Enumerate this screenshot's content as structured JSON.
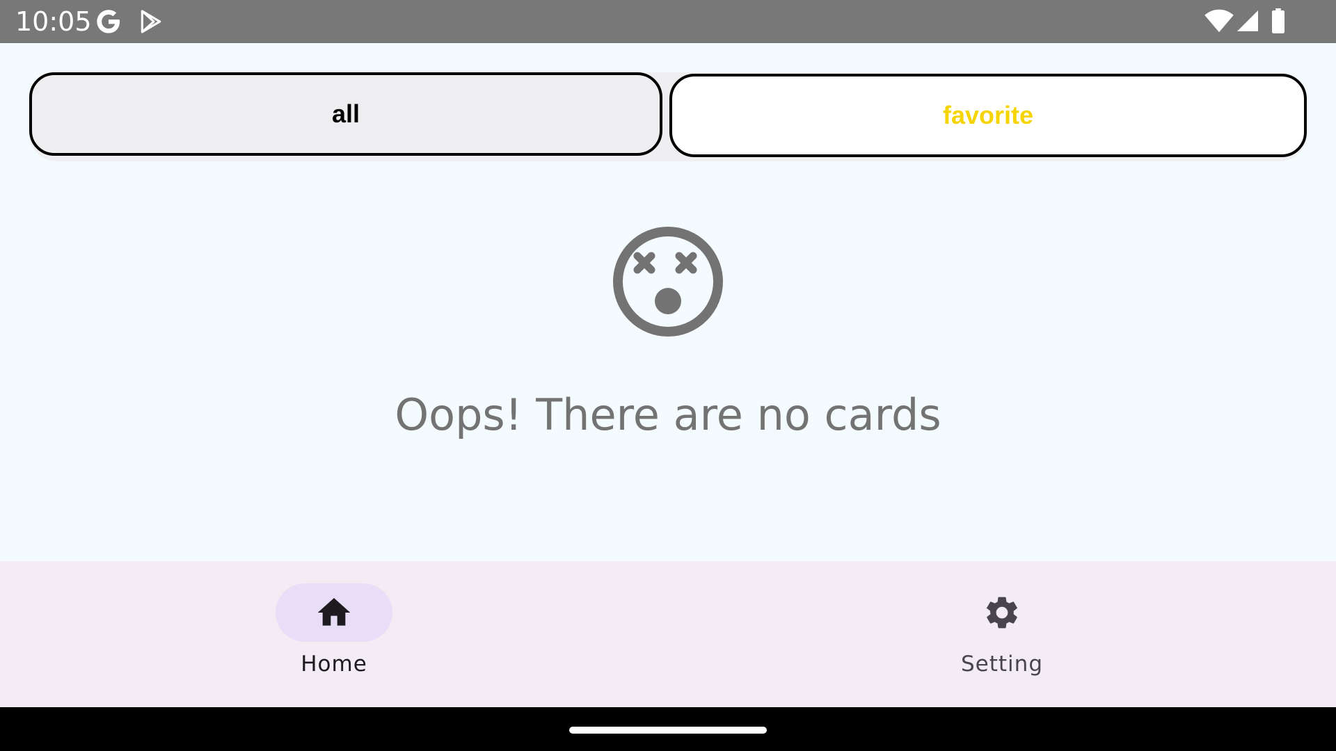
{
  "status_bar": {
    "time": "10:05",
    "icons": [
      "google-icon",
      "play-store-icon",
      "wifi-icon",
      "cell-signal-icon",
      "battery-icon"
    ]
  },
  "tabs": [
    {
      "label": "all",
      "selected": true,
      "text_color": "#000000"
    },
    {
      "label": "favorite",
      "selected": false,
      "text_color": "#f6d400"
    }
  ],
  "empty_state": {
    "icon": "dizzy-face-icon",
    "message": "Oops! There are no cards"
  },
  "bottom_nav": {
    "items": [
      {
        "label": "Home",
        "icon": "home-icon",
        "active": true
      },
      {
        "label": "Setting",
        "icon": "gear-icon",
        "active": false
      }
    ]
  },
  "colors": {
    "background": "#f3fbfe",
    "status_bar": "#787878",
    "nav_background": "#f3ecf4",
    "nav_active_pill": "#e8def8",
    "favorite_text": "#f6d400",
    "muted_text": "#737373"
  }
}
